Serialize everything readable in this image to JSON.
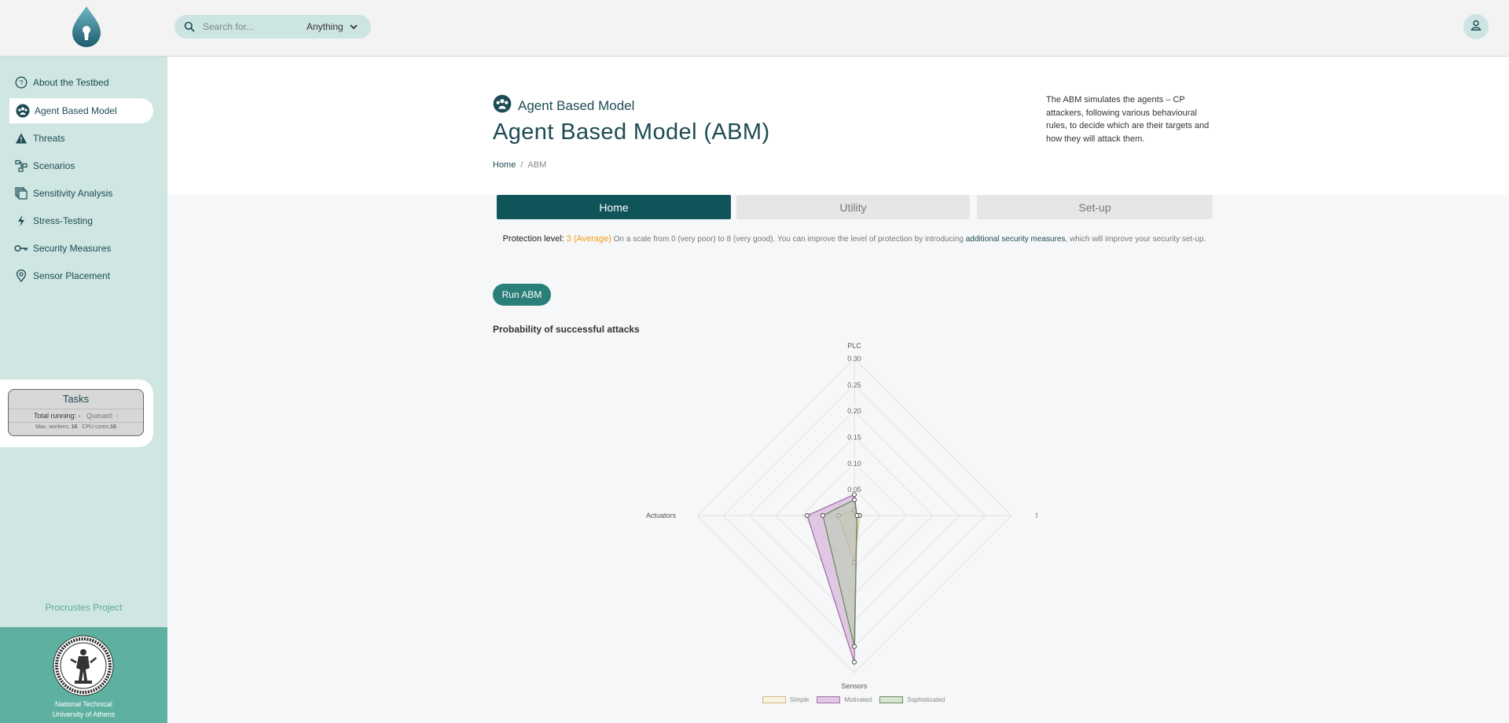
{
  "search": {
    "placeholder": "Search for...",
    "scope": "Anything"
  },
  "sidebar": {
    "items": [
      {
        "label": "About the Testbed",
        "icon": "question-circle-icon"
      },
      {
        "label": "Agent Based Model",
        "icon": "agents-icon",
        "active": true
      },
      {
        "label": "Threats",
        "icon": "warning-triangle-icon"
      },
      {
        "label": "Scenarios",
        "icon": "diagram-icon"
      },
      {
        "label": "Sensitivity Analysis",
        "icon": "layers-icon"
      },
      {
        "label": "Stress-Testing",
        "icon": "lightning-icon"
      },
      {
        "label": "Security Measures",
        "icon": "key-icon"
      },
      {
        "label": "Sensor Placement",
        "icon": "location-pin-icon"
      }
    ],
    "tasks": {
      "title": "Tasks",
      "total_running_label": "Total running:",
      "total_running_value": "-",
      "queued_label": "Queued:",
      "queued_value": "-",
      "max_workers_label": "Max. workers:",
      "max_workers_value": "16",
      "cpu_cores_label": "CPU cores:",
      "cpu_cores_value": "16"
    },
    "project": "Procrustes Project",
    "university": {
      "line1": "National Technical",
      "line2": "University of Athens"
    }
  },
  "header": {
    "subtitle": "Agent Based Model",
    "title": "Agent Based Model (ABM)",
    "breadcrumb": {
      "home": "Home",
      "sep": "/",
      "current": "ABM"
    },
    "description": "The ABM simulates the agents – CP attackers, following various behavioural rules, to decide which are their targets and how they will attack them."
  },
  "tabs": [
    "Home",
    "Utility",
    "Set-up"
  ],
  "protection": {
    "label": "Protection level:",
    "level": "3 (Average)",
    "text_before": "On a scale from 0 (very poor) to 8 (very good). You can improve the level of protection by introducing",
    "link": "additional security measures",
    "text_after": ", which will improve your security set-up."
  },
  "run_button": "Run ABM",
  "colors": {
    "accent": "#0f5459",
    "sidebar": "#cfe6e2",
    "warning": "#f39c12"
  },
  "chart_data": {
    "type": "radar",
    "title": "Probability of successful attacks",
    "axes": [
      "PLC",
      "SCADA",
      "Sensors",
      "Actuators"
    ],
    "ticks": [
      "0.30",
      "0.25",
      "0.20",
      "0.15",
      "0.10",
      "0.05"
    ],
    "rmax": 0.3,
    "series": [
      {
        "name": "Simple",
        "values": [
          0.01,
          0.01,
          0.09,
          0.03
        ],
        "color": "#d6b98a",
        "fill": "rgba(245,238,205,0.55)"
      },
      {
        "name": "Motivated",
        "values": [
          0.04,
          0.005,
          0.28,
          0.09
        ],
        "color": "#a471a6",
        "fill": "rgba(206,162,214,0.55)"
      },
      {
        "name": "Sophisticated",
        "values": [
          0.03,
          0.005,
          0.25,
          0.06
        ],
        "color": "#6a8e5b",
        "fill": "rgba(175,205,160,0.45)"
      }
    ],
    "legend": "bottom"
  }
}
